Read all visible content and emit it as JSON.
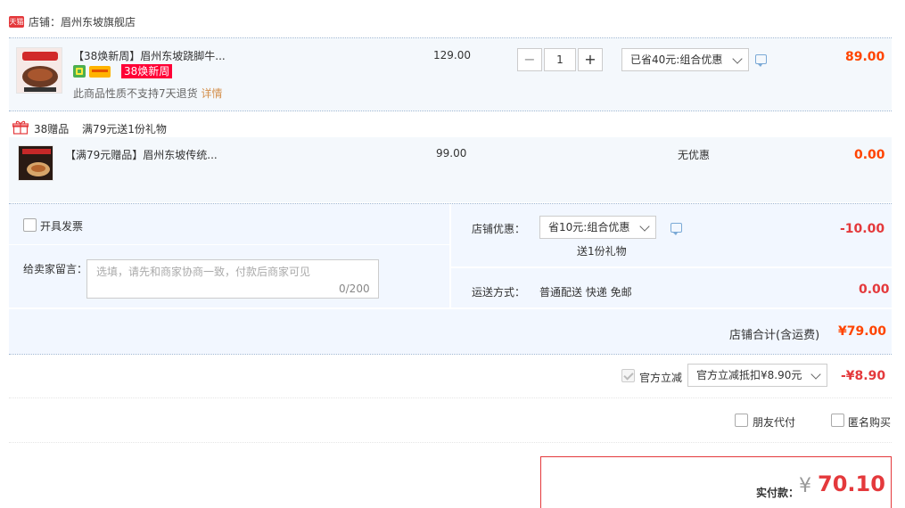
{
  "shop": {
    "badge": "天猫",
    "label": "店铺：",
    "name": "眉州东坡旗舰店"
  },
  "item1": {
    "title": "【38焕新周】眉州东坡跷脚牛...",
    "tag": "38焕新周",
    "notice": "此商品性质不支持7天退货",
    "detail_link": "详情",
    "unit_price": "129.00",
    "quantity": "1",
    "minus": "−",
    "plus": "+",
    "discount_select": "已省40元:组合优惠",
    "subtotal": "89.00"
  },
  "gift_section": {
    "label": "38赠品",
    "rule": "满79元送1份礼物"
  },
  "item2": {
    "title": "【满79元赠品】眉州东坡传统...",
    "unit_price": "99.00",
    "discount": "无优惠",
    "subtotal": "0.00"
  },
  "invoice": {
    "label": "开具发票"
  },
  "message": {
    "label": "给卖家留言：",
    "placeholder": "选填，请先和商家协商一致，付款后商家可见",
    "counter": "0/200"
  },
  "shop_discount": {
    "label": "店铺优惠：",
    "select": "省10元:组合优惠",
    "gift_note": "送1份礼物",
    "amount": "-10.00"
  },
  "shipping": {
    "label": "运送方式：",
    "method": "普通配送 快递 免邮",
    "amount": "0.00"
  },
  "shop_total": {
    "label": "店铺合计(含运费)",
    "amount": "¥79.00"
  },
  "official_discount": {
    "label": "官方立减",
    "select": "官方立减抵扣¥8.90元",
    "amount": "-¥8.90"
  },
  "options": {
    "friend_pay": "朋友代付",
    "anonymous": "匿名购买"
  },
  "final": {
    "label": "实付款：",
    "currency": "¥",
    "amount": "70.10"
  },
  "colors": {
    "accent_red": "#e4393c",
    "price_orange": "#ff4400",
    "tag_red": "#ff0036",
    "panel_blue": "#f4f8fc"
  },
  "icons": [
    "tmall-badge",
    "gift-icon",
    "chat-icon",
    "chevron-down-icon",
    "checkbox"
  ]
}
